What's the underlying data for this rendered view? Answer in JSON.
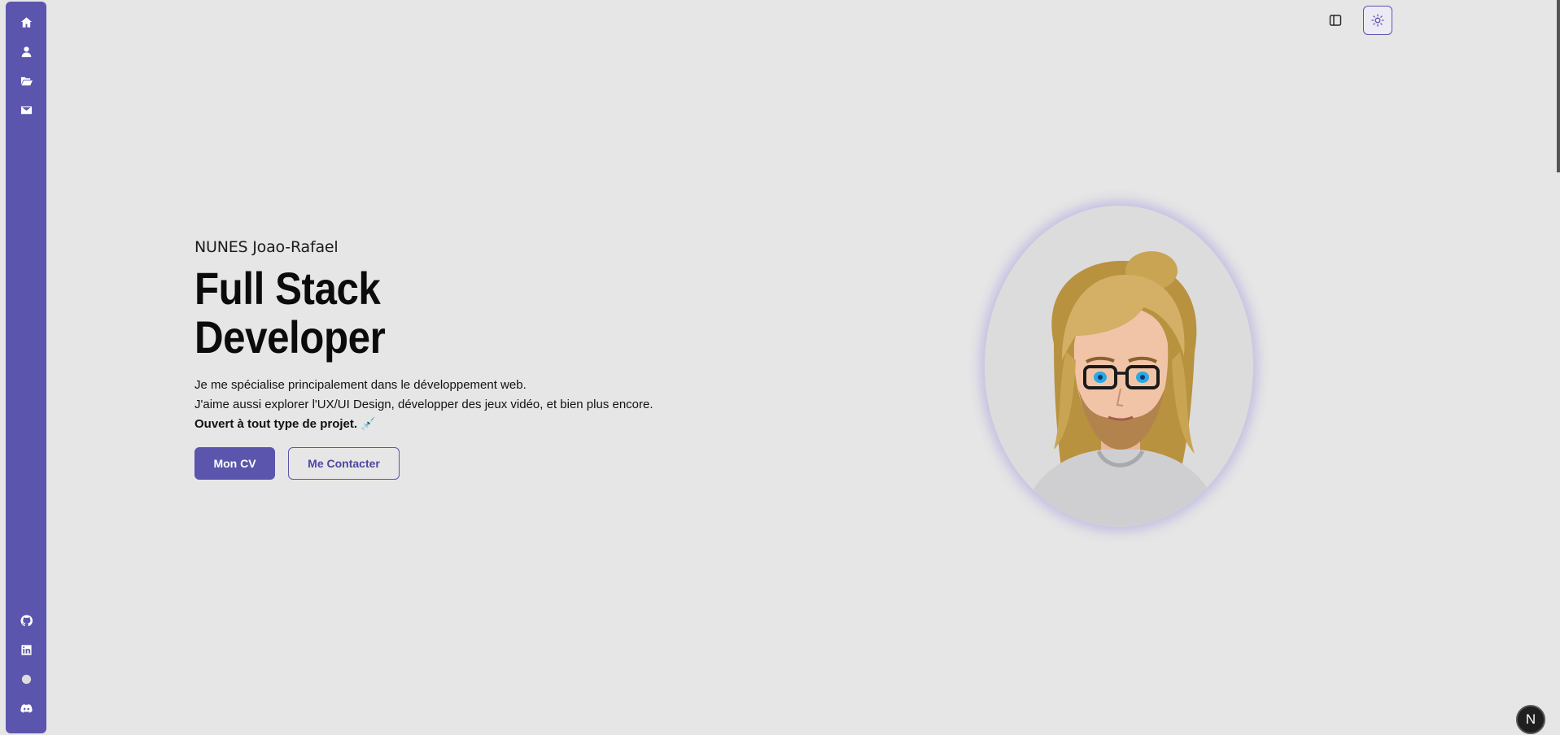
{
  "sidebar": {
    "top_items": [
      {
        "icon": "home-icon"
      },
      {
        "icon": "user-icon"
      },
      {
        "icon": "folder-open-icon"
      },
      {
        "icon": "envelope-icon"
      }
    ],
    "bottom_items": [
      {
        "icon": "github-icon"
      },
      {
        "icon": "linkedin-icon"
      },
      {
        "icon": "circle-icon"
      },
      {
        "icon": "discord-icon"
      }
    ]
  },
  "topbar": {
    "layout_icon": "sidebar-layout-icon",
    "theme_icon": "sun-icon"
  },
  "hero": {
    "name": "NUNES Joao-Rafael",
    "title_line1": "Full Stack",
    "title_line2": "Developer",
    "desc_line1": "Je me spécialise principalement dans le développement web.",
    "desc_line2": "J'aime aussi explorer l'UX/UI Design, développer des jeux vidéo, et bien plus encore.",
    "desc_line3": "Ouvert à tout type de projet.",
    "desc_emoji": "💉",
    "cv_button": "Mon CV",
    "contact_button": "Me Contacter"
  },
  "badge": {
    "label": "N"
  },
  "colors": {
    "accent": "#5b55ad",
    "background": "#e6e6e6"
  }
}
